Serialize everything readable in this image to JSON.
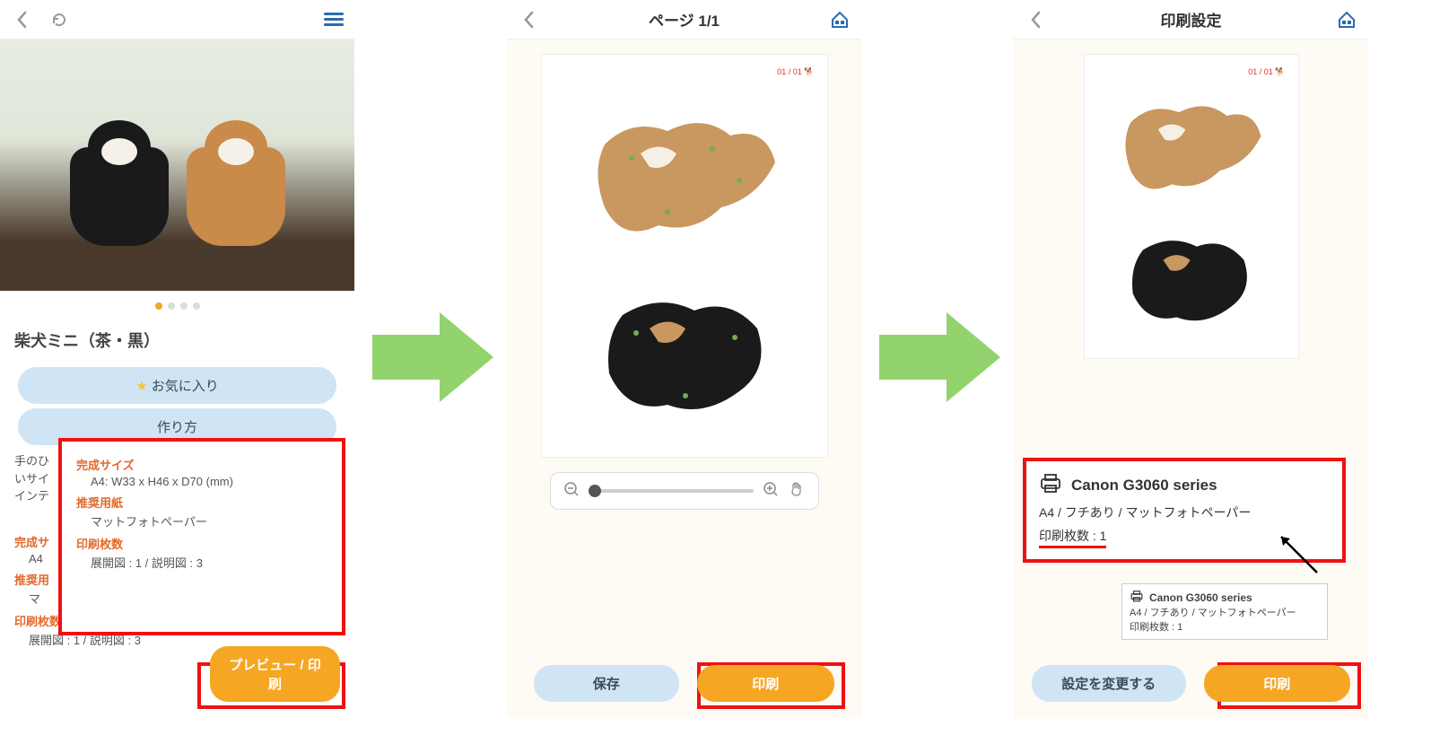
{
  "screen1": {
    "title": "柴犬ミニ（茶・黒）",
    "favorite_label": "お気に入り",
    "howto_label": "作り方",
    "body_prefix": "手のひ\nいサイ\nインテ",
    "spec_size_label": "完成サイズ",
    "spec_size_value": "A4: W33 x H46 x D70 (mm)",
    "spec_paper_label": "推奨用紙",
    "spec_paper_value": "マットフォトペーパー",
    "spec_count_label": "印刷枚数",
    "spec_count_value": "展開図 : 1 / 説明図 : 3",
    "bg_size_label": "完成サ",
    "bg_size_value": "A4",
    "bg_paper_label": "推奨用",
    "bg_paper_value": "マ",
    "bg_count_label": "印刷枚数",
    "bg_count_value": "展開図 : 1 / 説明図 : 3",
    "preview_print_btn": "プレビュー / 印刷"
  },
  "screen2": {
    "header": "ページ 1/1",
    "pp_badge": "01 / 01",
    "save_btn": "保存",
    "print_btn": "印刷"
  },
  "screen3": {
    "header": "印刷設定",
    "pp_badge": "01 / 01",
    "printer_name": "Canon G3060 series",
    "paper_line": "A4 / フチあり / マットフォトペーパー",
    "count_line": "印刷枚数 : 1",
    "small_printer_name": "Canon G3060 series",
    "small_paper_line": "A4 / フチあり / マットフォトペーパー",
    "small_count_line": "印刷枚数 : 1",
    "settings_btn": "設定を変更する",
    "print_btn": "印刷"
  }
}
